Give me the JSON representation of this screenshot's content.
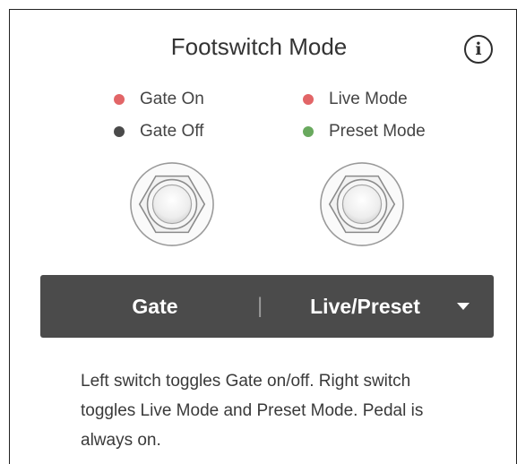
{
  "header": {
    "title": "Footswitch Mode",
    "info_icon": "info-circle-icon",
    "info_glyph": "i"
  },
  "legend_left": [
    {
      "label": "Gate On",
      "color": "#e26567"
    },
    {
      "label": "Gate Off",
      "color": "#4a4a4a"
    }
  ],
  "legend_right": [
    {
      "label": "Live Mode",
      "color": "#e26567"
    },
    {
      "label": "Preset Mode",
      "color": "#69a95e"
    }
  ],
  "mode_select": {
    "left_label": "Gate",
    "separator": "|",
    "right_label": "Live/Preset",
    "dropdown_icon": "caret-down-icon"
  },
  "description": "Left switch toggles Gate on/off. Right switch toggles Live Mode and Preset Mode. Pedal is always on."
}
